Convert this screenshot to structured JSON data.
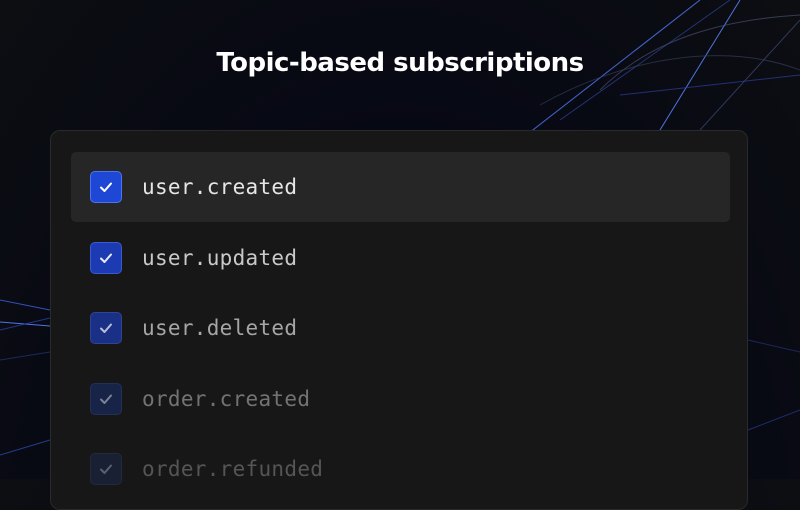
{
  "page": {
    "title": "Topic-based subscriptions"
  },
  "topics": [
    {
      "label": "user.created",
      "checked": true,
      "highlighted": true,
      "box_color": "#1f47d6",
      "box_border": "#4e73f0",
      "check_color": "#ffffff",
      "text_color": "#e6e6e6"
    },
    {
      "label": "user.updated",
      "checked": true,
      "highlighted": false,
      "box_color": "#1c3bb2",
      "box_border": "#3a5ad0",
      "check_color": "#e8ebf5",
      "text_color": "#c9c9c9"
    },
    {
      "label": "user.deleted",
      "checked": true,
      "highlighted": false,
      "box_color": "#1a2f86",
      "box_border": "#2e4596",
      "check_color": "#b9bfd1",
      "text_color": "#a6a6a6"
    },
    {
      "label": "order.created",
      "checked": true,
      "highlighted": false,
      "box_color": "#182447",
      "box_border": "#223058",
      "check_color": "#7b8297",
      "text_color": "#737373"
    },
    {
      "label": "order.refunded",
      "checked": true,
      "highlighted": false,
      "box_color": "#1a2033",
      "box_border": "#222a3d",
      "check_color": "#5a6070",
      "text_color": "#555555"
    }
  ],
  "icons": {
    "check": "checkmark-icon"
  },
  "colors": {
    "panel_bg": "#171717",
    "highlight_row_bg": "#262626",
    "accent_blue": "#1f47d6",
    "line_blue": "#3a6cf0"
  }
}
